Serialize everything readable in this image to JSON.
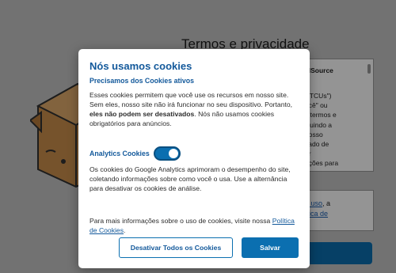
{
  "background_page": {
    "title": "Termos e privacidade",
    "panel_heading": "alSource",
    "panel_lines": "(\"TCUs\")\nocê\" ou\ns termos e\ncluindo a\nnosso\ncado de\ner\nações para\nl que pode\nalizamos",
    "terms_text_1": "e uso",
    "terms_text_2": ", a",
    "terms_link_2": "ítica de"
  },
  "modal": {
    "title": "Nós usamos cookies",
    "required_heading": "Precisamos dos Cookies ativos",
    "required_text_before": "Esses cookies permitem que você use os recursos em nosso site. Sem eles, nosso site não irá funcionar no seu dispositivo. Portanto, ",
    "required_text_bold": "eles não podem ser desativados",
    "required_text_after": ". Nós não usamos cookies obrigatórios para anúncios.",
    "analytics_label": "Analytics Cookies",
    "analytics_enabled": true,
    "analytics_text": "Os cookies do Google Analytics aprimoram o desempenho do site, coletando informações sobre como você o usa. Use a alternância para desativar os cookies de análise.",
    "more_info_text": "Para mais informações sobre o uso de cookies, visite nossa ",
    "policy_link": "Política de Cookies",
    "more_info_end": ".",
    "deactivate_button": "Desativar Todos os Cookies",
    "save_button": "Salvar"
  },
  "colors": {
    "accent": "#0b6fb0",
    "heading": "#13599b",
    "overlay": "rgba(0,0,0,0.42)"
  }
}
